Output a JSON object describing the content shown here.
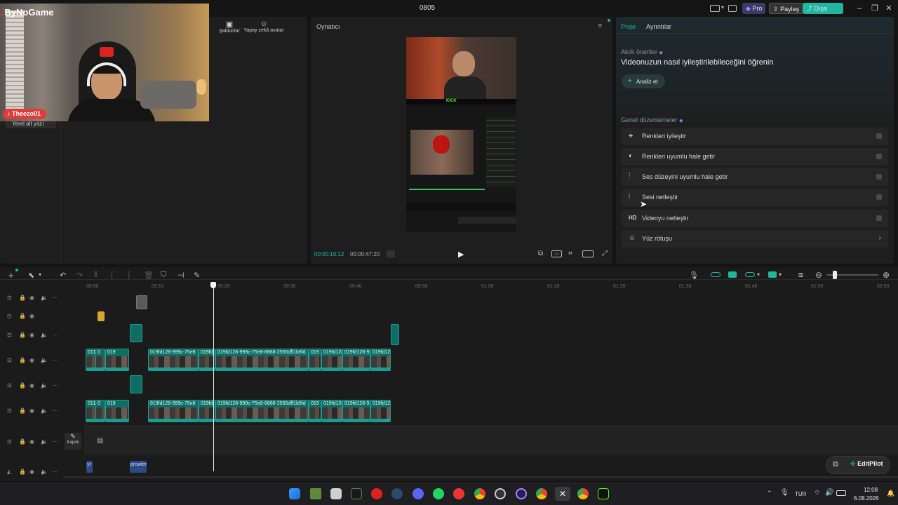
{
  "window": {
    "title": "0805"
  },
  "titlebar": {
    "pro_label": "Pro",
    "share_label": "Paylaş",
    "export_label": "Dışa Aktar"
  },
  "overlay": {
    "brand": "ByNoGame",
    "streamer_tag": "Theezo01"
  },
  "media_panel": {
    "tabs": [
      {
        "label": "Şablonlar",
        "icon": "template-icon"
      },
      {
        "label": "Yapay zekâ avatar",
        "icon": "ai-avatar-icon"
      }
    ],
    "sidebar_item": "Yerel alt yazı"
  },
  "player": {
    "title": "Oynatıcı",
    "current_time": "00:00:19:12",
    "total_time": "00:00:47:20",
    "kick_label": "KICK"
  },
  "right_panel": {
    "tabs": [
      "Proje",
      "Ayrıntılar"
    ],
    "smart_title": "Akıllı öneriler",
    "smart_heading": "Videonuzun nasıl iyileştirilebileceğini öğrenin",
    "analyze_label": "Analiz et",
    "general_title": "Genel düzenlemeler",
    "options": [
      {
        "label": "Renkleri iyileştir",
        "icon": "magic-wand-icon",
        "control": "toggle"
      },
      {
        "label": "Renkleri uyumlu hale getir",
        "icon": "color-match-icon",
        "control": "toggle"
      },
      {
        "label": "Ses düzeyini uyumlu hale getir",
        "icon": "equalizer-icon",
        "control": "toggle"
      },
      {
        "label": "Sesi netleştir",
        "icon": "audio-wave-icon",
        "control": "toggle"
      },
      {
        "label": "Videoyu netleştir",
        "icon": "hd-icon",
        "control": "toggle"
      },
      {
        "label": "Yüz rötuşu",
        "icon": "face-icon",
        "control": "chevron"
      }
    ]
  },
  "timeline": {
    "ruler": [
      "00:00",
      "00:10",
      "00:20",
      "00:30",
      "00:40",
      "00:50",
      "01:00",
      "01:10",
      "01:20",
      "01:30",
      "01:40",
      "01:50",
      "02:00"
    ],
    "clip_labels": {
      "a": "011",
      "b": "0",
      "c": "019",
      "d": "019fd128-999c-75e8",
      "e": "019fd",
      "f": "019fd128-999c-75e8-8868-2555dff1b5fd",
      "g": "019",
      "h": "019fd128",
      "i": "019fd128-9",
      "j": "019fd12"
    },
    "cover_label": "Kapak",
    "text_clip_1": "yt",
    "text_clip_2": "prowler",
    "editpilot_label": "EditPilot"
  },
  "taskbar": {
    "lang": "TUR",
    "time": "12:08",
    "date": "6.08.2026"
  },
  "colors": {
    "accent_teal": "#1fb5a0",
    "export_btn": "#20b6a3",
    "pro_btn": "#3c3a66",
    "record_red": "#e03a3a"
  }
}
